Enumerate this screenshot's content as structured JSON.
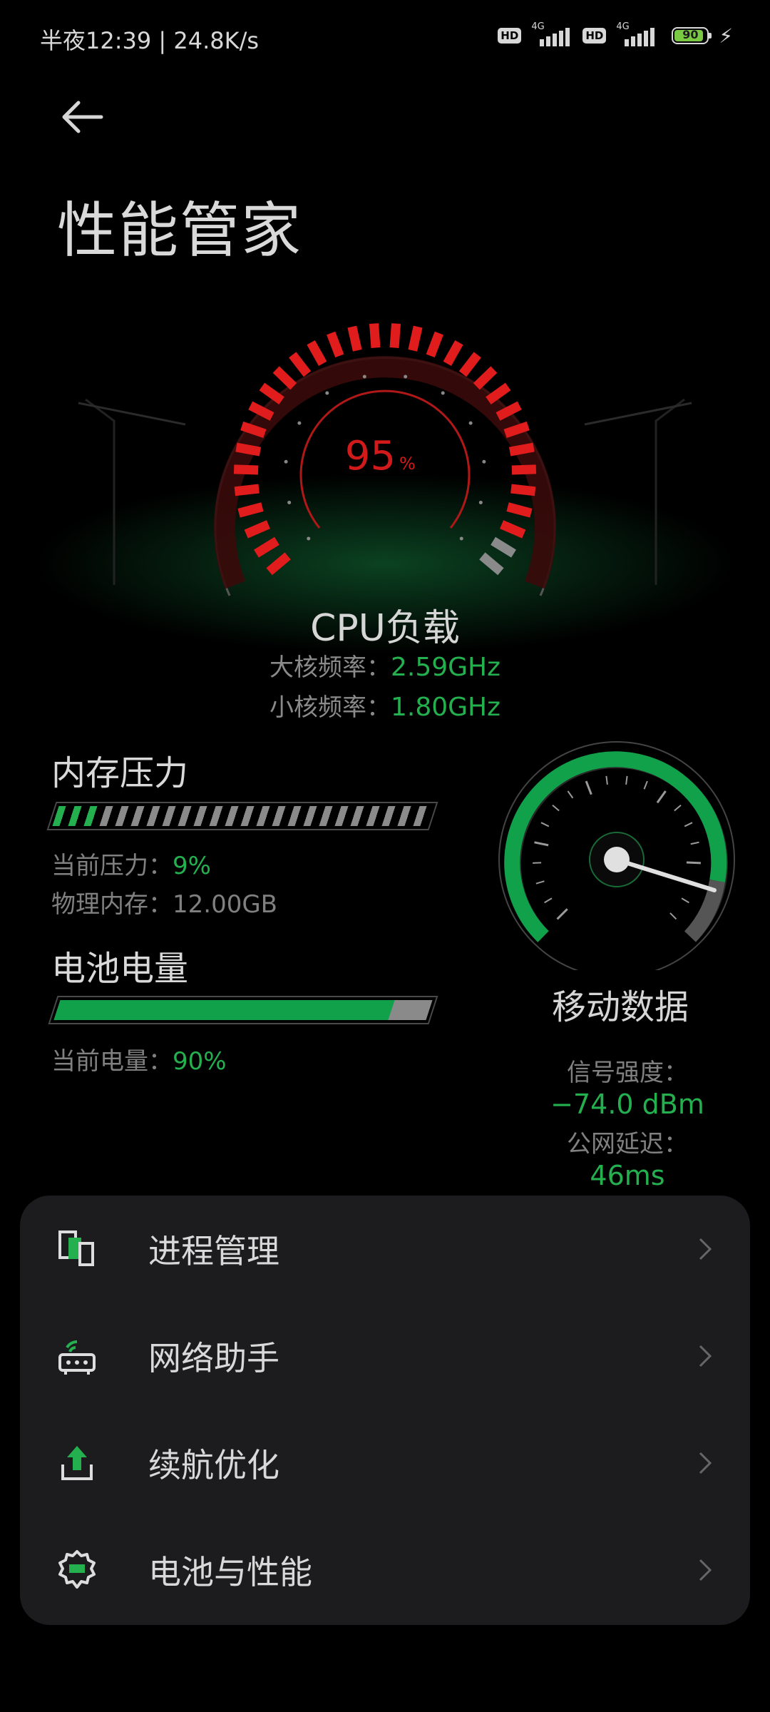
{
  "status_bar": {
    "time": "半夜12:39 | 24.8K/s",
    "hd": "HD",
    "net_type": "4G",
    "battery": "90"
  },
  "page": {
    "title": "性能管家"
  },
  "cpu": {
    "load_value": "95",
    "load_unit": "%",
    "load_level": 0.95,
    "label": "CPU负载",
    "big_core_label": "大核频率：",
    "big_core_value": "2.59GHz",
    "little_core_label": "小核频率：",
    "little_core_value": "1.80GHz"
  },
  "memory": {
    "title": "内存压力",
    "pressure_label": "当前压力：",
    "pressure_value": "9%",
    "pressure_level": 0.09,
    "physical_label": "物理内存：12.00GB"
  },
  "battery_section": {
    "title": "电池电量",
    "level_label": "当前电量：",
    "level_value": "90%",
    "level": 0.9
  },
  "mobile_data": {
    "title": "移动数据",
    "signal_label": "信号强度：",
    "signal_value": "−74.0 dBm",
    "latency_label": "公网延迟：",
    "latency_value": "46ms"
  },
  "menu": {
    "items": [
      {
        "label": "进程管理",
        "icon": "process-icon"
      },
      {
        "label": "网络助手",
        "icon": "router-icon"
      },
      {
        "label": "续航优化",
        "icon": "battery-upload-icon"
      },
      {
        "label": "电池与性能",
        "icon": "gear-battery-icon"
      }
    ]
  },
  "colors": {
    "accent_green": "#24b04f",
    "gauge_red": "#d21a1a",
    "card_bg": "#1c1c1e"
  }
}
